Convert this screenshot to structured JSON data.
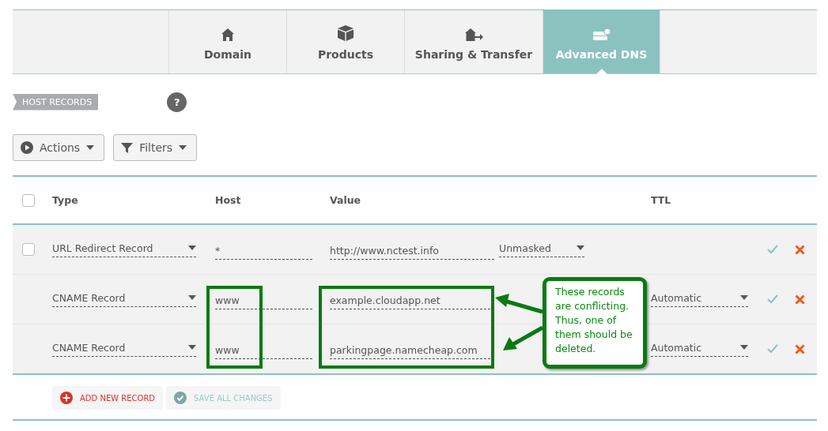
{
  "tabs": [
    {
      "label": "Domain",
      "selected": false
    },
    {
      "label": "Products",
      "selected": false
    },
    {
      "label": "Sharing & Transfer",
      "selected": false
    },
    {
      "label": "Advanced DNS",
      "selected": true
    }
  ],
  "section": {
    "title": "HOST RECORDS",
    "help": "?"
  },
  "toolbar": [
    {
      "label": "Actions"
    },
    {
      "label": "Filters"
    }
  ],
  "table": {
    "columns": [
      "Type",
      "Host",
      "Value",
      "TTL"
    ],
    "select_all_checked": false,
    "rows": [
      {
        "kind": "url_redirect",
        "checked": false,
        "type": "URL Redirect Record",
        "host": "*",
        "value": "http://www.nctest.info",
        "mode": "Unmasked"
      },
      {
        "kind": "cname",
        "type": "CNAME Record",
        "host": "www",
        "value": "example.cloudapp.net",
        "ttl": "Automatic"
      },
      {
        "kind": "cname",
        "type": "CNAME Record",
        "host": "www",
        "value": "parkingpage.namecheap.com",
        "ttl": "Automatic"
      }
    ]
  },
  "footer": {
    "add": "ADD NEW RECORD",
    "save": "SAVE ALL CHANGES",
    "save_disabled": true
  },
  "annotation": {
    "text": "These records are conflicting. Thus, one of them should be deleted."
  }
}
